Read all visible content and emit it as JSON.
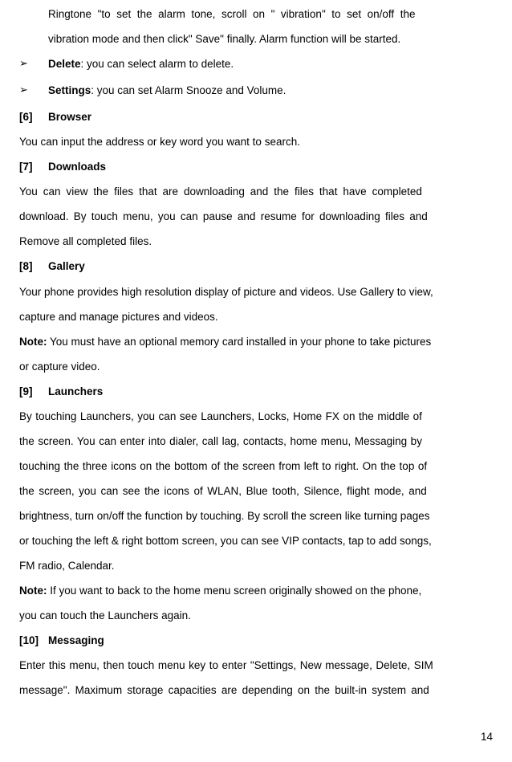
{
  "intro": {
    "line1": "Ringtone \"to set the alarm tone, scroll on \" vibration\" to set on/off the",
    "line2": "vibration mode and then click\" Save\" finally. Alarm function will be started."
  },
  "bullets": {
    "marker": "➢",
    "delete_label": "Delete",
    "delete_rest": ": you can select alarm to delete.",
    "settings_label": "Settings",
    "settings_rest": ": you can set Alarm Snooze and Volume."
  },
  "section6": {
    "num": "[6]",
    "title": "Browser",
    "body": "You can input the address or key word you want to search."
  },
  "section7": {
    "num": "[7]",
    "title": "Downloads",
    "body1": "You can view the files that are downloading and the files that have completed",
    "body2": "download. By touch menu, you can pause and resume for downloading files and",
    "body3": "Remove all completed files."
  },
  "section8": {
    "num": "[8]",
    "title": "Gallery",
    "body1": "Your phone provides high resolution display of picture and videos. Use Gallery to view,",
    "body2": "capture and manage pictures and videos.",
    "note_label": "Note:",
    "note_rest1": " You must have an optional memory card installed in your phone to take pictures",
    "note_rest2": "or capture video."
  },
  "section9": {
    "num": "[9]",
    "title": "Launchers",
    "body1": "By touching Launchers, you can see Launchers, Locks, Home FX on the middle of",
    "body2": "the screen. You can enter into dialer, call lag, contacts, home menu, Messaging by",
    "body3": "touching the three icons on the bottom of the screen from left to right. On the top of",
    "body4": "the screen, you can see the icons of WLAN, Blue tooth, Silence, flight mode, and",
    "body5": "brightness, turn on/off the function by touching. By scroll the screen like turning pages",
    "body6": "or touching the left & right bottom screen, you can see VIP contacts, tap to add songs,",
    "body7": "FM radio, Calendar.",
    "note_label": "Note:",
    "note_rest1": " If you want to back to the home menu screen originally showed on the phone,",
    "note_rest2": "you can touch the Launchers again."
  },
  "section10": {
    "num": "[10]",
    "title": "Messaging",
    "body1": "Enter this menu, then touch menu key to enter \"Settings, New message, Delete, SIM",
    "body2": "message\". Maximum storage capacities are depending on the built-in system and"
  },
  "pageNumber": "14"
}
